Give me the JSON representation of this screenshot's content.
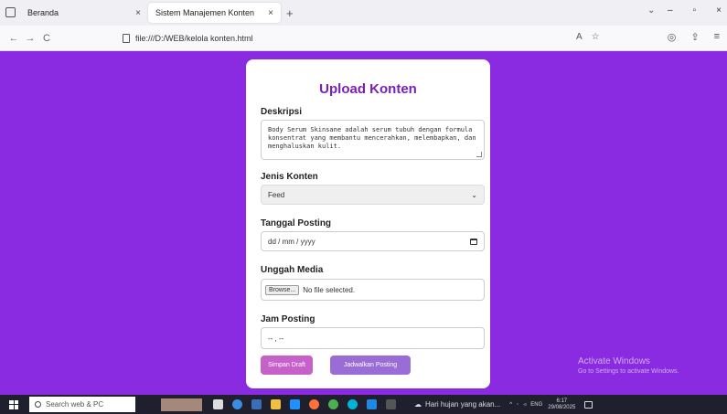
{
  "browser": {
    "tabs": [
      {
        "title": "Beranda",
        "active": false
      },
      {
        "title": "Sistem Manajemen Konten",
        "active": true
      }
    ],
    "url": "file:///D:/WEB/kelola konten.html",
    "close_glyph": "×",
    "new_tab_glyph": "+",
    "nav": {
      "back": "←",
      "forward": "→",
      "reload": "C"
    },
    "window_controls": {
      "dropdown": "⌄",
      "minimize": "–",
      "maximize": "▫",
      "close": "×"
    },
    "toolbar_icons": {
      "translate": "A",
      "bookmark": "☆",
      "account": "◎",
      "share": "⇪",
      "menu": "≡"
    }
  },
  "form": {
    "title": "Upload Konten",
    "description_label": "Deskripsi",
    "description_value": "Body Serum Skinsane adalah serum tubuh dengan formula konsentrat yang membantu mencerahkan, melembapkan, dan menghaluskan kulit.",
    "type_label": "Jenis Konten",
    "type_value": "Feed",
    "type_chevron": "⌄",
    "date_label": "Tanggal Posting",
    "date_placeholder": "dd / mm / yyyy",
    "media_label": "Unggah Media",
    "browse_label": "Browse...",
    "file_status": "No file selected.",
    "time_label": "Jam Posting",
    "time_placeholder": "-- , --",
    "draft_button": "Simpan Draft",
    "schedule_button": "Jadwalkan Posting"
  },
  "watermark": {
    "line1": "Activate Windows",
    "line2": "Go to Settings to activate Windows."
  },
  "taskbar": {
    "search_placeholder": "Search web & PC",
    "weather": "Hari hujan yang akan...",
    "tray_caret": "^",
    "language": "ENG",
    "time": "6:17",
    "date": "29/08/2025"
  },
  "colors": {
    "page_bg": "#8a2be2",
    "title": "#7a1fb5",
    "draft_button": "#c561c9",
    "schedule_button": "#9a6cd6"
  }
}
